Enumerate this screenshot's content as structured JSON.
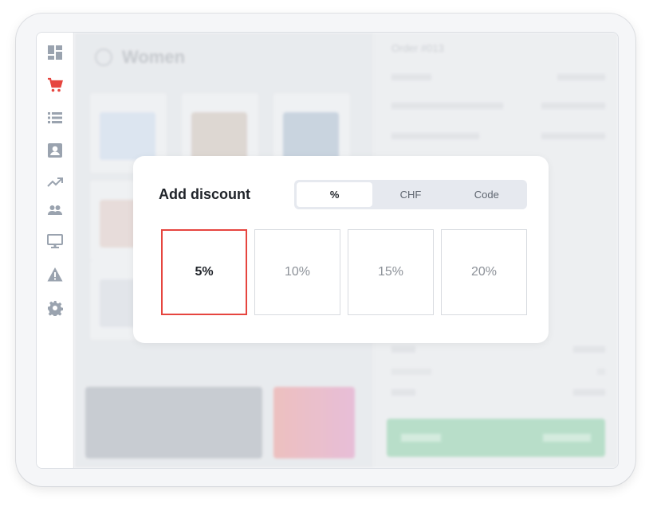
{
  "sidebar": {
    "items": [
      {
        "name": "dashboard-icon",
        "active": false
      },
      {
        "name": "cart-icon",
        "active": true
      },
      {
        "name": "list-icon",
        "active": false
      },
      {
        "name": "contact-card-icon",
        "active": false
      },
      {
        "name": "trending-up-icon",
        "active": false
      },
      {
        "name": "people-icon",
        "active": false
      },
      {
        "name": "monitor-icon",
        "active": false
      },
      {
        "name": "warning-icon",
        "active": false
      },
      {
        "name": "gear-icon",
        "active": false
      }
    ],
    "colors": {
      "icon": "#9aa3af",
      "active": "#e6453f"
    }
  },
  "background": {
    "page_title": "Women",
    "order_title": "Order #013"
  },
  "discount_modal": {
    "title": "Add discount",
    "tabs": [
      {
        "label": "%",
        "active": true
      },
      {
        "label": "CHF",
        "active": false
      },
      {
        "label": "Code",
        "active": false
      }
    ],
    "options": [
      {
        "label": "5%",
        "selected": true
      },
      {
        "label": "10%",
        "selected": false
      },
      {
        "label": "15%",
        "selected": false
      },
      {
        "label": "20%",
        "selected": false
      }
    ],
    "colors": {
      "selected_border": "#e6453f",
      "tab_bg": "#e6e9ef"
    }
  }
}
